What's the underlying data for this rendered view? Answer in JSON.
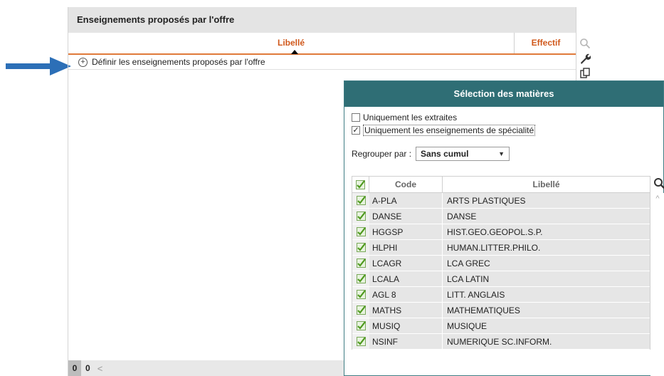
{
  "panel": {
    "title": "Enseignements proposés par l'offre",
    "col_libelle": "Libellé",
    "col_effectif": "Effectif",
    "define_label": "Définir les enseignements proposés par l'offre",
    "page_current": "0",
    "page_total": "0",
    "page_prev_glyph": "<"
  },
  "dialog": {
    "title": "Sélection des matières",
    "chk_extraites": {
      "label": "Uniquement les extraites",
      "checked": false
    },
    "chk_specialite": {
      "label": "Uniquement les enseignements de spécialité",
      "checked": true
    },
    "group_label": "Regrouper par :",
    "group_value": "Sans cumul",
    "table": {
      "headers": {
        "code": "Code",
        "libelle": "Libellé"
      },
      "rows": [
        {
          "code": "A-PLA",
          "libelle": "ARTS PLASTIQUES"
        },
        {
          "code": "DANSE",
          "libelle": "DANSE"
        },
        {
          "code": "HGGSP",
          "libelle": "HIST.GEO.GEOPOL.S.P."
        },
        {
          "code": "HLPHI",
          "libelle": "HUMAN.LITTER.PHILO."
        },
        {
          "code": "LCAGR",
          "libelle": "LCA GREC"
        },
        {
          "code": "LCALA",
          "libelle": "LCA LATIN"
        },
        {
          "code": "AGL 8",
          "libelle": "LITT. ANGLAIS"
        },
        {
          "code": "MATHS",
          "libelle": "MATHEMATIQUES"
        },
        {
          "code": "MUSIQ",
          "libelle": "MUSIQUE"
        },
        {
          "code": "NSINF",
          "libelle": "NUMERIQUE SC.INFORM."
        }
      ]
    }
  },
  "colors": {
    "accent_orange": "#e07a3a",
    "dialog_title_bg": "#2f6e75",
    "arrow_blue": "#2c6fb7",
    "check_green": "#5cae2e"
  },
  "icons": [
    "plus-circle-icon",
    "search-icon",
    "wrench-icon",
    "copy-icon",
    "arrow-right-icon",
    "green-check-icon",
    "chevron-up-icon"
  ]
}
